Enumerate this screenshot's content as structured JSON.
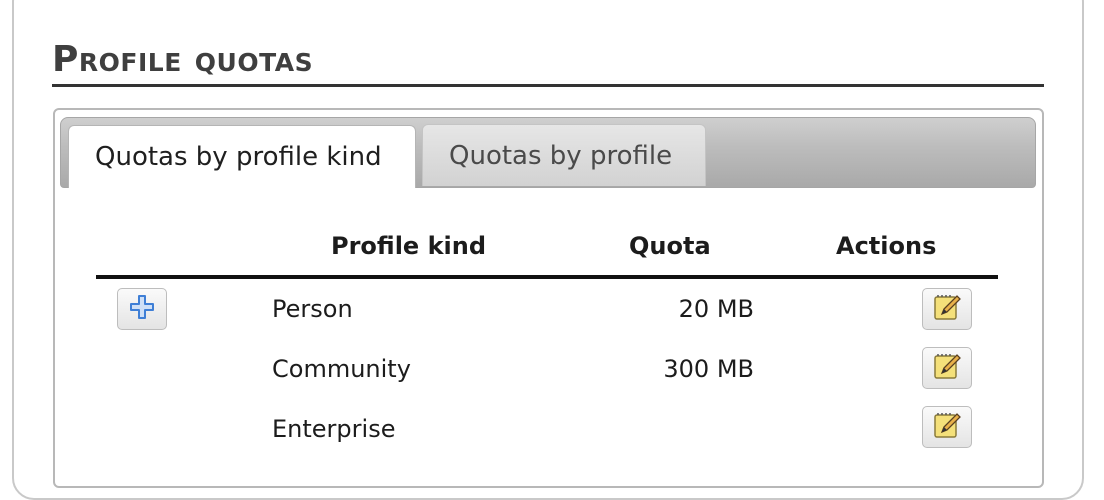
{
  "page": {
    "title": "Profile quotas"
  },
  "tabs": [
    {
      "label": "Quotas by profile kind",
      "active": true
    },
    {
      "label": "Quotas by profile",
      "active": false
    }
  ],
  "table": {
    "headers": {
      "kind": "Profile kind",
      "quota": "Quota",
      "actions": "Actions"
    },
    "rows": [
      {
        "kind": "Person",
        "quota": "20 MB",
        "action_icon": "edit-icon"
      },
      {
        "kind": "Community",
        "quota": "300 MB",
        "action_icon": "edit-icon"
      },
      {
        "kind": "Enterprise",
        "quota": "",
        "action_icon": "edit-icon"
      }
    ],
    "add_icon": "plus-icon"
  },
  "colors": {
    "title_text": "#3f3f3f",
    "add_icon": "#3f7fd6",
    "edit_pad": "#f4e07a"
  }
}
